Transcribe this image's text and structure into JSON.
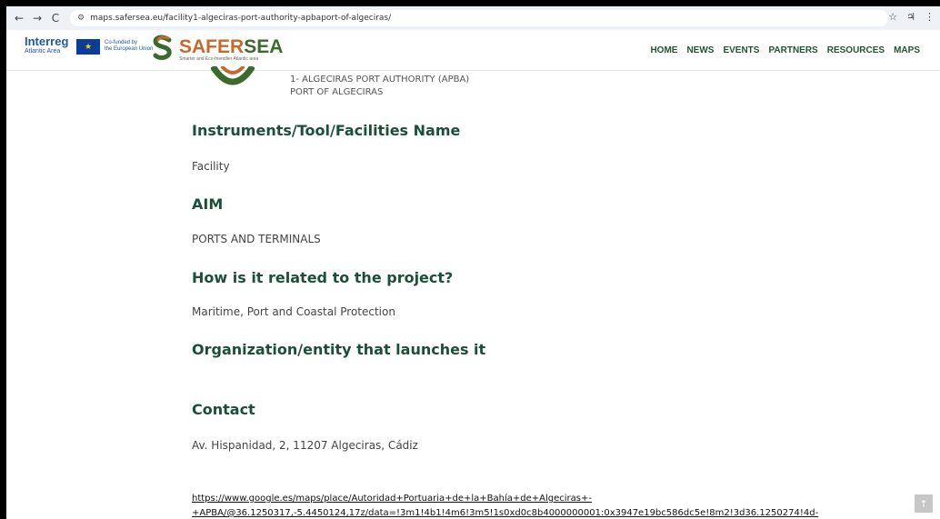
{
  "browser": {
    "back": "←",
    "forward": "→",
    "reload": "C",
    "url": "maps.safersea.eu/facility1-algeciras-port-authority-apbaport-of-algeciras/",
    "star": "☆",
    "extension": "♃",
    "menu": "⋮"
  },
  "header": {
    "interreg": "Interreg",
    "interreg_sub": "Atlantic Area",
    "eu_line1": "Co-funded by",
    "eu_line2": "the European Union",
    "logo_safer": "SAFER",
    "logo_sea": "SEA",
    "logo_tagline": "Smarter and Eco-friendlier Atlantic area",
    "nav": [
      "HOME",
      "NEWS",
      "EVENTS",
      "PARTNERS",
      "RESOURCES",
      "MAPS"
    ]
  },
  "partner": {
    "line1": "1- ALGECIRAS PORT AUTHORITY (APBA)",
    "line2": "PORT OF ALGECIRAS"
  },
  "sections": {
    "instruments_heading": "Instruments/Tool/Facilities Name",
    "instruments_value": "Facility",
    "aim_heading": "AIM",
    "aim_value": "PORTS AND TERMINALS",
    "related_heading": "How is it related to the project?",
    "related_value": "Maritime, Port and Coastal Protection",
    "org_heading": "Organization/entity that launches it",
    "contact_heading": "Contact",
    "contact_address": "Av. Hispanidad, 2, 11207 Algeciras, Cádiz",
    "map_link_line1": "https://www.google.es/maps/place/Autoridad+Portuaria+de+la+Bahía+de+Algeciras+-",
    "map_link_line2": "+APBA/@36.1250317,-5.4450124,17z/data=!3m1!4b1!4m6!3m5!1s0xd0c8b4000000001:0x3947e19bc586dc5e!8m2!3d36.1250274!4d-"
  },
  "scroll_top": "↑",
  "colors": {
    "heading": "#1c4f3a",
    "nav": "#235233",
    "logo_orange": "#c56a2d",
    "logo_green": "#3a6b2c"
  }
}
